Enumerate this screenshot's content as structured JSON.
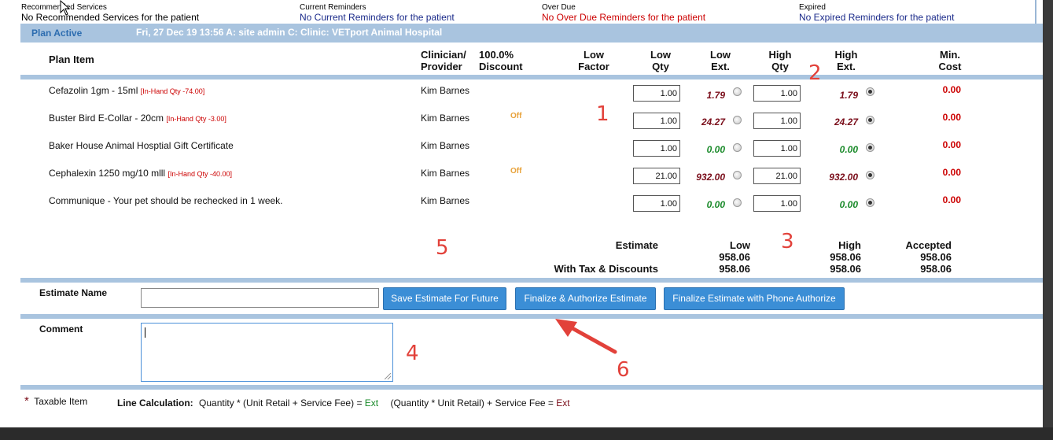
{
  "reminders": {
    "recommended": {
      "heading": "Recommended Services",
      "value": "No Recommended Services for the patient"
    },
    "current": {
      "heading": "Current Reminders",
      "value": "No Current Reminders for the patient"
    },
    "overdue": {
      "heading": "Over Due",
      "value": "No Over Due Reminders for the patient"
    },
    "expired": {
      "heading": "Expired",
      "value": "No Expired Reminders for the patient"
    }
  },
  "banner": {
    "status": "Plan Active",
    "info": "Fri, 27 Dec 19 13:56  A: site admin  C:  Clinic: VETport Animal Hospital"
  },
  "columns": {
    "plan_item": "Plan Item",
    "clinician": [
      "Clinician/",
      "Provider"
    ],
    "discount": [
      "100.0%",
      "Discount"
    ],
    "low_factor": [
      "Low",
      "Factor"
    ],
    "low_qty": [
      "Low",
      "Qty"
    ],
    "low_ext": [
      "Low",
      "Ext."
    ],
    "high_qty": [
      "High",
      "Qty"
    ],
    "high_ext": [
      "High",
      "Ext."
    ],
    "min_cost": [
      "Min.",
      "Cost"
    ]
  },
  "items": [
    {
      "name": "Cefazolin 1gm - 15ml",
      "stock": "[In-Hand Qty -74.00]",
      "clinician": "Kim Barnes",
      "discount": "",
      "low_qty": "1.00",
      "low_ext": "1.79",
      "low_ext_color": "#7a0d1a",
      "high_qty": "1.00",
      "high_ext": "1.79",
      "high_ext_color": "#7a0d1a",
      "min_cost": "0.00"
    },
    {
      "name": "Buster Bird E-Collar - 20cm",
      "stock": "[In-Hand Qty -3.00]",
      "clinician": "Kim Barnes",
      "discount": "Off",
      "low_qty": "1.00",
      "low_ext": "24.27",
      "low_ext_color": "#7a0d1a",
      "high_qty": "1.00",
      "high_ext": "24.27",
      "high_ext_color": "#7a0d1a",
      "min_cost": "0.00"
    },
    {
      "name": "Baker House Animal Hosptial Gift Certificate",
      "stock": "",
      "clinician": "Kim Barnes",
      "discount": "",
      "low_qty": "1.00",
      "low_ext": "0.00",
      "low_ext_color": "#1a8a2a",
      "high_qty": "1.00",
      "high_ext": "0.00",
      "high_ext_color": "#1a8a2a",
      "min_cost": "0.00"
    },
    {
      "name": "Cephalexin 1250 mg/10 mlll",
      "stock": "[In-Hand Qty -40.00]",
      "clinician": "Kim Barnes",
      "discount": "Off",
      "low_qty": "21.00",
      "low_ext": "932.00",
      "low_ext_color": "#7a0d1a",
      "high_qty": "21.00",
      "high_ext": "932.00",
      "high_ext_color": "#7a0d1a",
      "min_cost": "0.00"
    },
    {
      "name": "Communique - Your pet should be rechecked in 1 week.",
      "stock": "",
      "clinician": "Kim Barnes",
      "discount": "",
      "low_qty": "1.00",
      "low_ext": "0.00",
      "low_ext_color": "#1a8a2a",
      "high_qty": "1.00",
      "high_ext": "0.00",
      "high_ext_color": "#1a8a2a",
      "min_cost": "0.00"
    }
  ],
  "annotations": [
    "1",
    "2",
    "3",
    "4",
    "5",
    "6"
  ],
  "totals": {
    "estimate_label": "Estimate",
    "tax_label": "With Tax & Discounts",
    "low_label": "Low",
    "high_label": "High",
    "accepted_label": "Accepted",
    "low_estimate": "958.06",
    "high_estimate": "958.06",
    "accepted_estimate": "958.06",
    "low_tax": "958.06",
    "high_tax": "958.06",
    "accepted_tax": "958.06"
  },
  "estimate": {
    "name_label": "Estimate Name",
    "name_value": "",
    "save_button": "Save Estimate For Future",
    "finalize_button": "Finalize & Authorize Estimate",
    "phone_button": "Finalize Estimate with Phone Authorize"
  },
  "comment": {
    "label": "Comment",
    "value": ""
  },
  "footer": {
    "star": "*",
    "taxable": "Taxable Item",
    "line_calc_label": "Line Calculation:",
    "formula1": "Quantity * (Unit Retail + Service Fee) = ",
    "formula1_ext": "Ext",
    "formula2": "(Quantity * Unit Retail) + Service Fee = ",
    "formula2_ext": "Ext"
  },
  "colors": {
    "accent": "#3b8ed6",
    "banner": "#a9c4df",
    "annotation": "#e2413a"
  }
}
